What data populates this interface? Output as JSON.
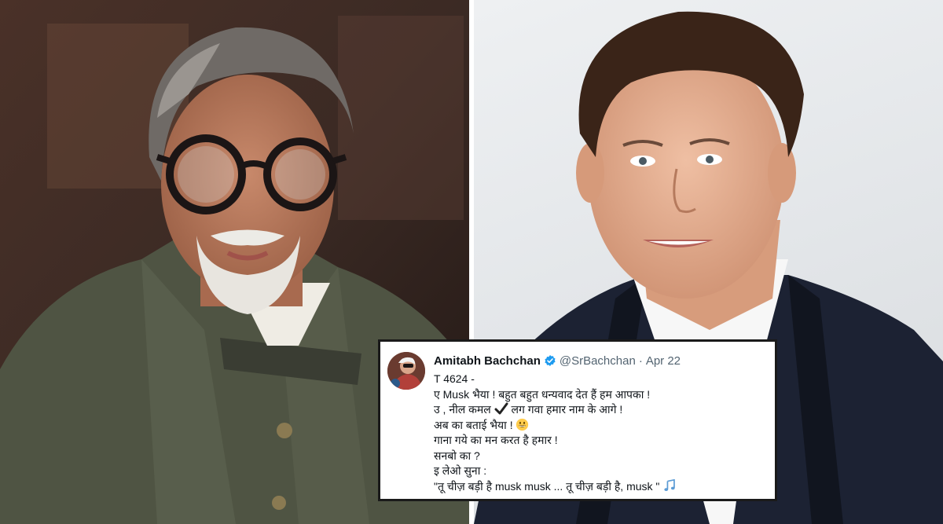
{
  "photos": {
    "left": {
      "subject": "Amitabh Bachchan"
    },
    "right": {
      "subject": "Elon Musk"
    }
  },
  "tweet": {
    "author_name": "Amitabh Bachchan",
    "handle": "@SrBachchan",
    "separator": "·",
    "date": "Apr 22",
    "lines": [
      "T 4624 -",
      "ए  Musk  भैया ! बहुत बहुत धन्यवाद देत हैं हम आपका !",
      "उ , नील कमल",
      " लग गवा हमार नाम के आगे !",
      "अब का बताई भैया !",
      "गाना गये का मन करत है हमार !",
      "सनबो का ?",
      "इ  लेओ सुना :",
      "\"तू चीज़ बड़ी है  musk musk ... तू चीज़ बड़ी है, musk \""
    ],
    "icons": {
      "verified": "verified-badge-icon",
      "check": "check-mark-icon",
      "grin": "grinning-face-icon",
      "music": "musical-notes-icon"
    },
    "colors": {
      "verified": "#1d9bf0",
      "text": "#0f1419",
      "muted": "#536471",
      "border": "#1a1a1a"
    }
  }
}
